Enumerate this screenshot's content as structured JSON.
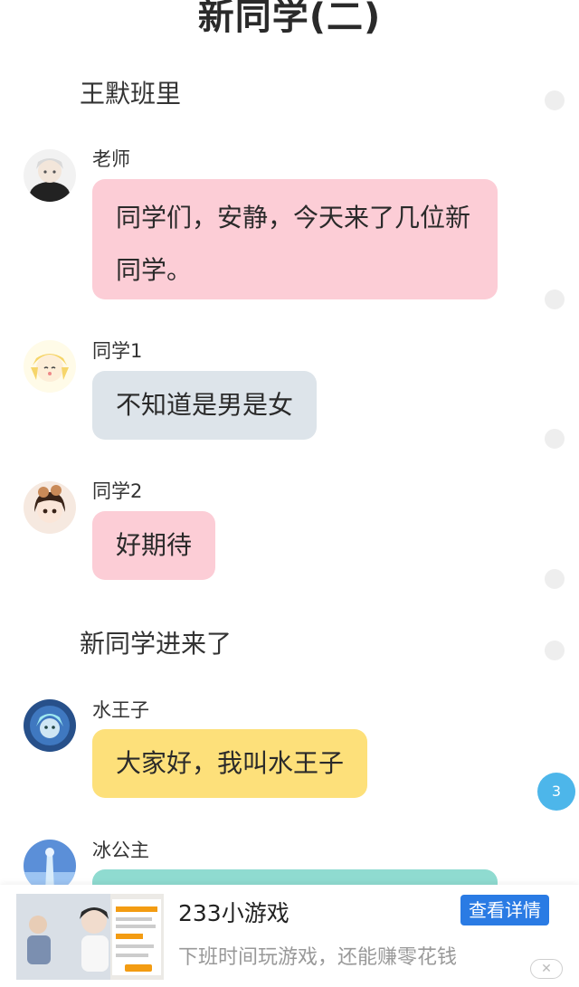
{
  "page": {
    "title": "新同学(二)"
  },
  "narrations": [
    "王默班里",
    "新同学进来了"
  ],
  "messages": [
    {
      "sender": "老师",
      "text": "同学们，安静，今天来了几位新同学。",
      "avatar_icon": "teacher-avatar-icon",
      "bubble_color": "#fccdd6"
    },
    {
      "sender": "同学1",
      "text": "不知道是男是女",
      "avatar_icon": "classmate1-avatar-icon",
      "bubble_color": "#dde4ea"
    },
    {
      "sender": "同学2",
      "text": "好期待",
      "avatar_icon": "classmate2-avatar-icon",
      "bubble_color": "#fccdd6"
    },
    {
      "sender": "水王子",
      "text": "大家好，我叫水王子",
      "avatar_icon": "water-prince-avatar-icon",
      "bubble_color": "#fde07a"
    },
    {
      "sender": "冰公主",
      "text": "",
      "avatar_icon": "ice-princess-avatar-icon",
      "bubble_color": "#8fdbd0"
    }
  ],
  "unread_badge": "3",
  "ad": {
    "title": "233小游戏",
    "subtitle": "下班时间玩游戏，还能赚零花钱",
    "button": "查看详情",
    "close": "✕"
  }
}
